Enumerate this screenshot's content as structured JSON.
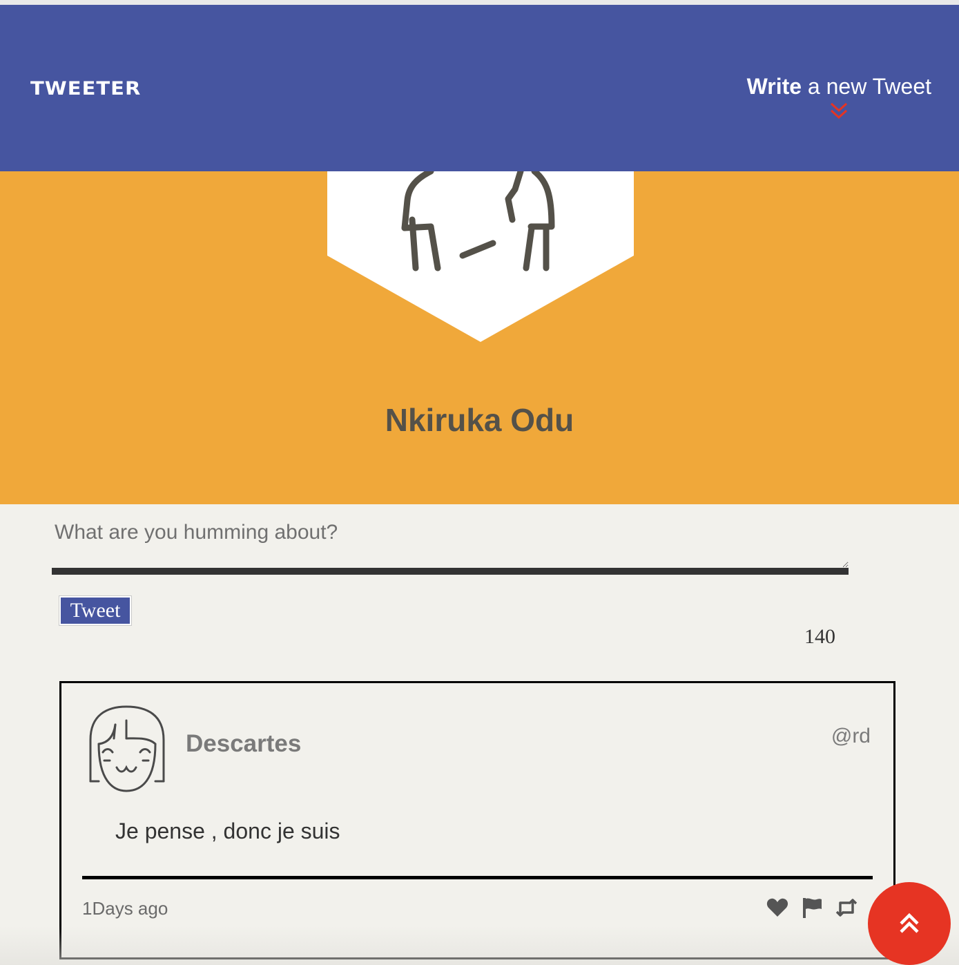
{
  "nav": {
    "brand": "TWEETER",
    "compose_toggle": {
      "strong": "Write",
      "rest": " a new Tweet"
    }
  },
  "profile": {
    "name": "Nkiruka Odu"
  },
  "compose": {
    "placeholder": "What are you humming about?",
    "value": "",
    "submit_label": "Tweet",
    "counter": "140"
  },
  "tweets": [
    {
      "name": "Descartes",
      "handle": "@rd",
      "text": "Je pense , donc je suis",
      "time": "1Days ago"
    }
  ],
  "colors": {
    "nav_bg": "#4655a0",
    "profile_bg": "#f0a83a",
    "page_bg": "#f2f1ec",
    "accent_red": "#e63423"
  },
  "icons": {
    "chevron": "double-chevron-down-icon",
    "like": "heart-icon",
    "flag": "flag-icon",
    "retweet": "retweet-icon",
    "scroll_top": "double-chevron-up-icon"
  }
}
